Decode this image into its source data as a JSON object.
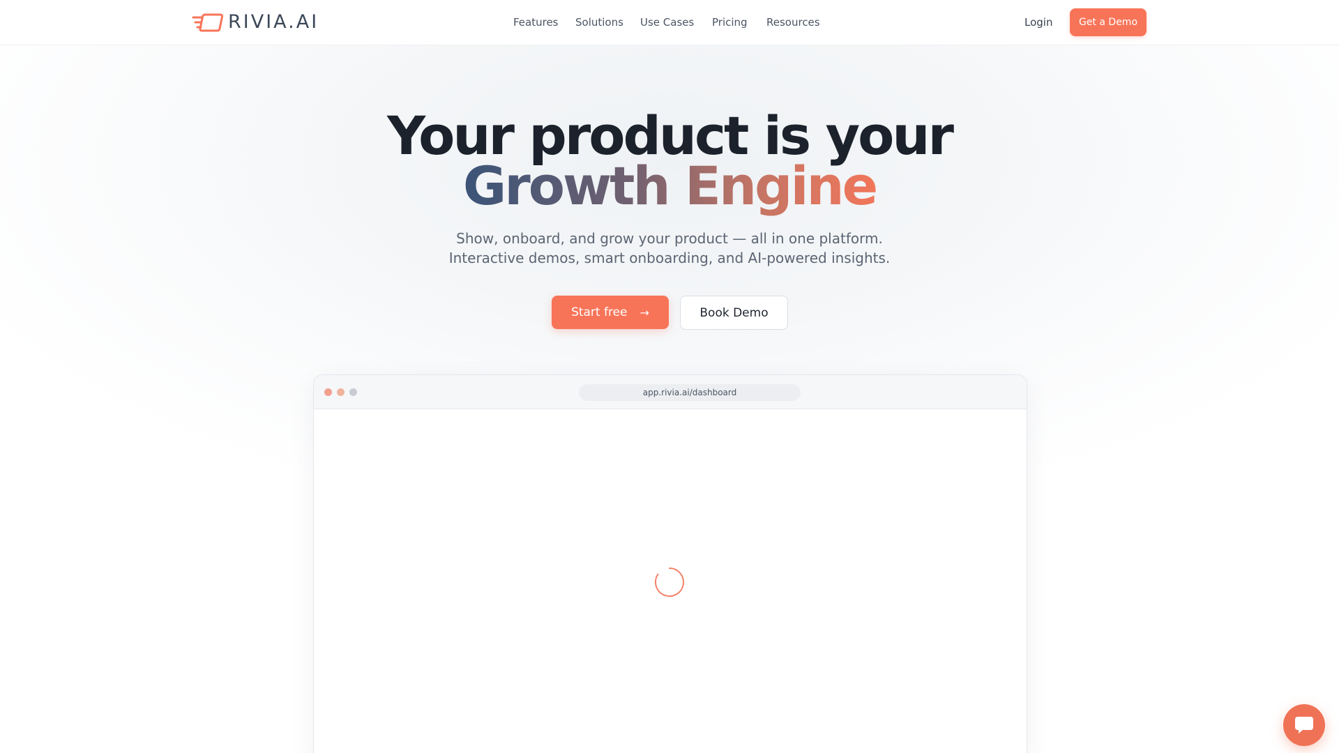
{
  "brand": {
    "name": "RIVIA.AI",
    "accent_color": "#f87458",
    "logo_icon": "speed-frame-logo-icon"
  },
  "nav": {
    "links": [
      "Features",
      "Solutions",
      "Use Cases",
      "Pricing",
      "Resources"
    ],
    "login_label": "Login",
    "demo_label": "Get a Demo"
  },
  "hero": {
    "title_line1": "Your product is your",
    "title_line2": "Growth Engine",
    "subtitle_line1": "Show, onboard, and grow your product — all in one platform.",
    "subtitle_line2": "Interactive demos, smart onboarding, and AI-powered insights.",
    "primary_cta": "Start free",
    "primary_cta_icon": "arrow-right-icon",
    "secondary_cta": "Book Demo"
  },
  "browser": {
    "url": "app.rivia.ai/dashboard",
    "window_controls": [
      "close-dot",
      "minimize-dot",
      "maximize-dot"
    ],
    "content_state": "loading",
    "loader_icon": "loading-spinner-icon"
  },
  "chat": {
    "icon": "chat-bubble-icon",
    "color": "#f07256"
  }
}
